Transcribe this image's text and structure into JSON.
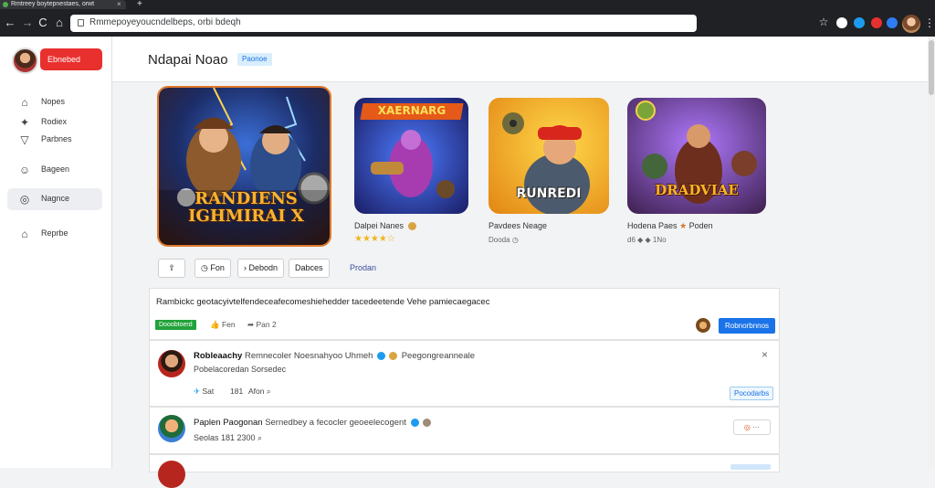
{
  "browser": {
    "tab_title": "Rmtreey boytepnestaes, orwt",
    "new_tab": "+",
    "url": "Rmmepoyeyoucndelbeps, orbi  bdeqh",
    "back": "←",
    "forward": "→",
    "reload": "C",
    "home": "⌂",
    "menu": "⋮",
    "extension_colors": [
      "#ffffff",
      "#1d9bf0",
      "#e8302f",
      "#2e7df5"
    ]
  },
  "sidebar": {
    "profile_button": "Ebnebed",
    "items": [
      {
        "icon": "home-icon",
        "glyph": "⌂",
        "label": "Nopes"
      },
      {
        "icon": "compass-icon",
        "glyph": "✦",
        "label": "Rodiex"
      },
      {
        "icon": "shield-icon",
        "glyph": "▽",
        "label": "Parbnes"
      },
      {
        "icon": "smile-icon",
        "glyph": "☺",
        "label": "Bageen"
      },
      {
        "icon": "chat-icon",
        "glyph": "◎",
        "label": "Nagnce",
        "active": true
      },
      {
        "icon": "house-icon",
        "glyph": "⌂",
        "label": "Reprbe"
      }
    ]
  },
  "header": {
    "title": "Ndapai Noao",
    "badge": "Paonoe"
  },
  "games": [
    {
      "art_line1": "RANDIENS",
      "art_line2": "IGHMIRAI X"
    },
    {
      "art_title": "XAERNARG",
      "title": "Dalpei Nanes",
      "rating_label": "★★★★☆"
    },
    {
      "art_title": "RUNREDI",
      "title": "Pavdees Neage",
      "sub": "Dooda"
    },
    {
      "art_title": "DRADVIAE",
      "title": "Hodena Paes",
      "title2": "Poden",
      "sub": "d6 ◆ ◆ 1No"
    }
  ],
  "actions": {
    "share": "⇧",
    "play": "Fon",
    "next": "Debodn",
    "save": "Dabces",
    "link": "Prodan"
  },
  "description": {
    "text": "Rambickc geotacyivtelfendeceafecomeshiehedder tacedeetende Vehe pamiecaegacec",
    "tag": "Dooobtoerd",
    "likes": "Fen",
    "shares": "Pan 2",
    "cta": "Robnorbnnos"
  },
  "comments": [
    {
      "name": "Robleaachy",
      "handle": "Remnecoler Noesnahyoo Uhmeh",
      "extra": "Peegongreanneale",
      "body": "Pobelacoredan Sorsedec",
      "reply": "Sat",
      "count": "181",
      "label": "Afon",
      "button": "Pocodarbs"
    },
    {
      "name": "Paplen Paogonan",
      "handle": "Sernedbey a fecocler geoeelecogent",
      "time": "Seolas  181 2300"
    }
  ]
}
